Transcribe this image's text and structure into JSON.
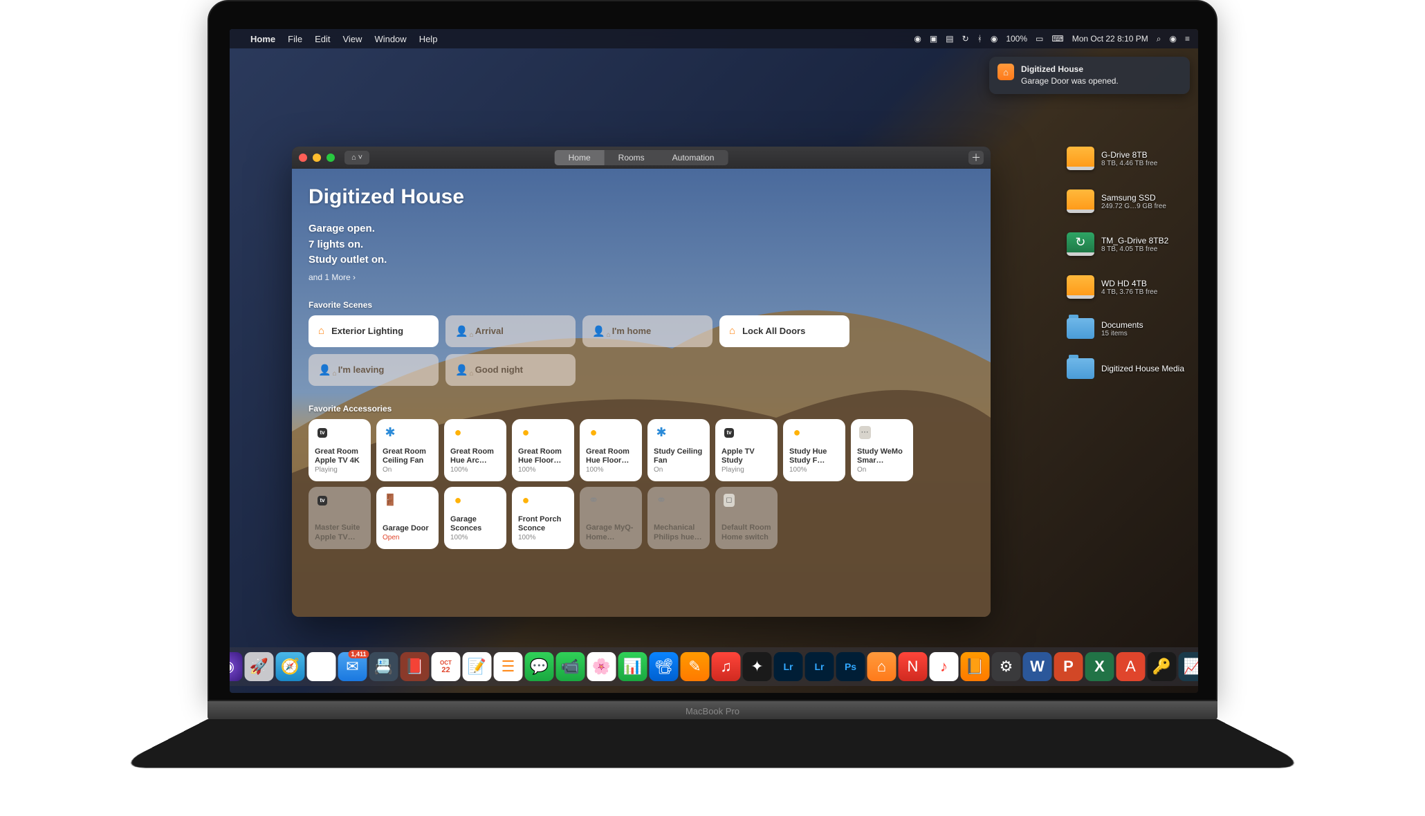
{
  "menubar": {
    "app": "Home",
    "menus": [
      "File",
      "Edit",
      "View",
      "Window",
      "Help"
    ],
    "battery": "100%",
    "clock": "Mon Oct 22  8:10 PM"
  },
  "notification": {
    "title": "Digitized House",
    "body": "Garage Door was opened."
  },
  "desktop": [
    {
      "type": "drive",
      "name": "G-Drive 8TB",
      "sub": "8 TB, 4.46 TB free"
    },
    {
      "type": "drive",
      "name": "Samsung SSD",
      "sub": "249.72 G…9 GB free"
    },
    {
      "type": "tm",
      "name": "TM_G-Drive 8TB2",
      "sub": "8 TB, 4.05 TB free"
    },
    {
      "type": "drive",
      "name": "WD HD 4TB",
      "sub": "4 TB, 3.76 TB free"
    },
    {
      "type": "folder",
      "name": "Documents",
      "sub": "15 items"
    },
    {
      "type": "folder",
      "name": "Digitized House Media",
      "sub": ""
    }
  ],
  "window": {
    "tabs": {
      "home": "Home",
      "rooms": "Rooms",
      "automation": "Automation"
    },
    "title": "Digitized House",
    "status": [
      "Garage open.",
      "7 lights on.",
      "Study outlet on."
    ],
    "more": "and 1 More ›",
    "scenes_label": "Favorite Scenes",
    "scenes": [
      {
        "label": "Exterior Lighting",
        "style": "solid",
        "icon": "home-orange"
      },
      {
        "label": "Arrival",
        "style": "dim",
        "icon": "person"
      },
      {
        "label": "I'm home",
        "style": "dim",
        "icon": "person"
      },
      {
        "label": "Lock All Doors",
        "style": "solid",
        "icon": "home-orange"
      },
      {
        "label": "I'm leaving",
        "style": "dim",
        "icon": "person"
      },
      {
        "label": "Good night",
        "style": "dim",
        "icon": "person"
      }
    ],
    "accessories_label": "Favorite Accessories",
    "tiles": [
      {
        "name": "Great Room Apple TV 4K",
        "status": "Playing",
        "state": "on",
        "icon": "atv"
      },
      {
        "name": "Great Room Ceiling Fan",
        "status": "On",
        "state": "on",
        "icon": "fan"
      },
      {
        "name": "Great Room Hue Arc Lamp",
        "status": "100%",
        "state": "on",
        "icon": "bulb"
      },
      {
        "name": "Great Room Hue Floor L…",
        "status": "100%",
        "state": "on",
        "icon": "bulb"
      },
      {
        "name": "Great Room Hue Floor L…",
        "status": "100%",
        "state": "on",
        "icon": "bulb"
      },
      {
        "name": "Study Ceiling Fan",
        "status": "On",
        "state": "on",
        "icon": "fan"
      },
      {
        "name": "Apple TV Study",
        "status": "Playing",
        "state": "on",
        "icon": "atv"
      },
      {
        "name": "Study Hue Study F…",
        "status": "100%",
        "state": "on",
        "icon": "bulb"
      },
      {
        "name": "Study WeMo Smar…",
        "status": "On",
        "state": "on",
        "icon": "switch"
      },
      {
        "name": "Master Suite Apple TV Be…",
        "status": "",
        "state": "off",
        "icon": "atv"
      },
      {
        "name": "Garage Door",
        "status": "Open",
        "state": "on",
        "icon": "garage",
        "statusClass": "red"
      },
      {
        "name": "Garage Sconces",
        "status": "100%",
        "state": "on",
        "icon": "bulb"
      },
      {
        "name": "Front Porch Sconce",
        "status": "100%",
        "state": "on",
        "icon": "bulb"
      },
      {
        "name": "Garage MyQ-Home…",
        "status": "",
        "state": "off",
        "icon": "bridge"
      },
      {
        "name": "Mechanical Philips hue…",
        "status": "",
        "state": "off",
        "icon": "bridge"
      },
      {
        "name": "Default Room Home switch",
        "status": "",
        "state": "off",
        "icon": "switch-off"
      }
    ]
  },
  "dock": {
    "mail_badge": "1,411",
    "hinge_label": "MacBook Pro"
  }
}
